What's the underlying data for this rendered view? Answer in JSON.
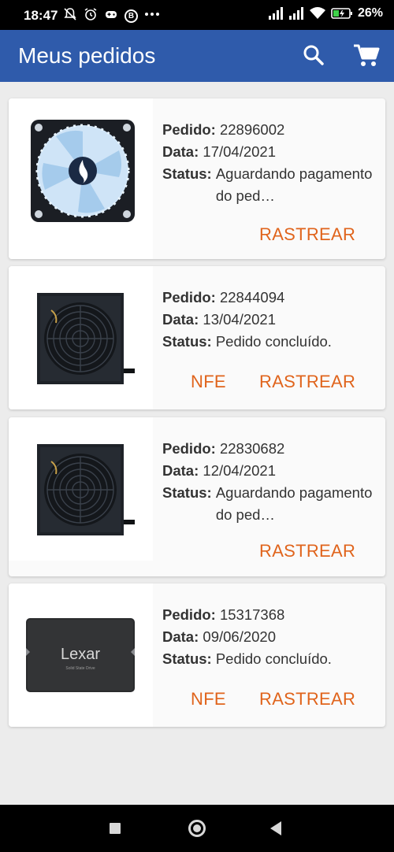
{
  "status_bar": {
    "time": "18:47",
    "battery_pct": "26%",
    "icons": [
      "mute-icon",
      "alarm-icon",
      "gamepad-icon",
      "b-badge-icon",
      "more-dots-icon",
      "signal-icon",
      "signal-icon",
      "wifi-icon",
      "battery-icon"
    ]
  },
  "app_bar": {
    "title": "Meus pedidos",
    "icons": [
      "search-icon",
      "cart-icon"
    ],
    "color": "#2f5bab"
  },
  "labels": {
    "order": "Pedido:",
    "date": "Data:",
    "status": "Status:"
  },
  "orders": [
    {
      "product": "led-fan-icon",
      "number": "22896002",
      "date": "17/04/2021",
      "status": "Aguardando pagamento do ped…",
      "actions": [
        "RASTREAR"
      ]
    },
    {
      "product": "power-supply-icon",
      "number": "22844094",
      "date": "13/04/2021",
      "status": "Pedido concluído.",
      "actions": [
        "NFE",
        "RASTREAR"
      ]
    },
    {
      "product": "power-supply-icon",
      "number": "22830682",
      "date": "12/04/2021",
      "status": "Aguardando pagamento do ped…",
      "actions": [
        "RASTREAR"
      ]
    },
    {
      "product": "ssd-icon",
      "number": "15317368",
      "date": "09/06/2020",
      "status": "Pedido concluído.",
      "actions": [
        "NFE",
        "RASTREAR"
      ],
      "brand": "Lexar",
      "brand_sub": "Solid State Drive"
    }
  ],
  "accent_color": "#e0641c",
  "nav_bar": {
    "icons": [
      "recents-square-icon",
      "home-circle-icon",
      "back-triangle-icon"
    ]
  }
}
